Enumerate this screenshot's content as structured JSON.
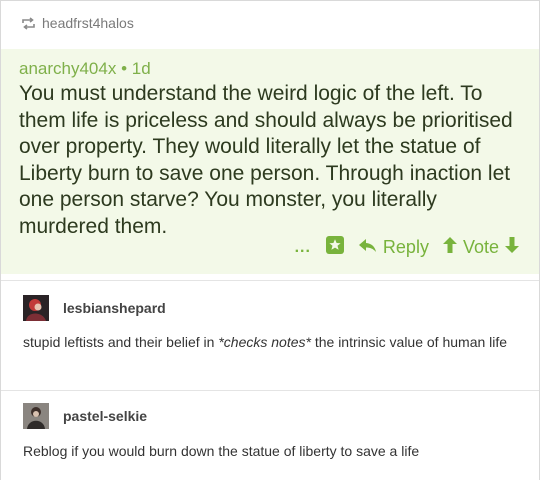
{
  "reblog": {
    "username": "headfrst4halos"
  },
  "quoted_post": {
    "author": "anarchy404x",
    "age": "1d",
    "body": "You must understand the weird logic of the left. To them life is priceless and should always be prioritised over property. They would literally let the statue of Liberty burn to save one person. Through inaction let one person starve? You monster, you literally murdered them.",
    "actions": {
      "more": "...",
      "reply_label": "Reply",
      "vote_label": "Vote"
    }
  },
  "replies": [
    {
      "username": "lesbianshepard",
      "text_before": "stupid leftists and their belief in ",
      "text_italic": "*checks notes*",
      "text_after": " the intrinsic value of human life"
    },
    {
      "username": "pastel-selkie",
      "text": "Reblog if you would burn down the statue of liberty to save a life"
    }
  ],
  "colors": {
    "accent_green": "#78b33c",
    "quote_background": "#f3f9e8"
  },
  "icons": [
    "reblog-icon",
    "star-icon",
    "reply-arrow-icon",
    "upvote-arrow-icon",
    "downvote-arrow-icon"
  ]
}
